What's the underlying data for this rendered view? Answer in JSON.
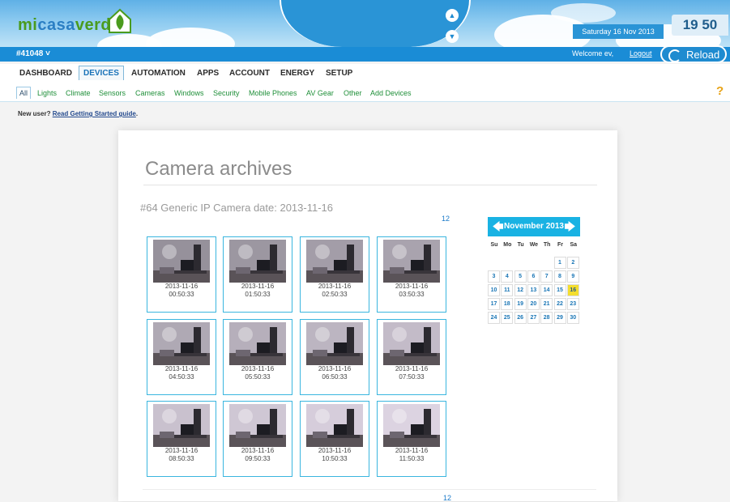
{
  "header": {
    "logo_part1": "mi",
    "logo_part2": "casa",
    "logo_part3": "verde",
    "date": "Saturday 16 Nov 2013",
    "time": "19 50",
    "device_id": "#41048",
    "welcome": "Welcome ev,",
    "logout": "Logout",
    "reload": "Reload"
  },
  "main_nav": [
    "DASHBOARD",
    "DEVICES",
    "AUTOMATION",
    "APPS",
    "ACCOUNT",
    "ENERGY",
    "SETUP"
  ],
  "main_nav_active": "DEVICES",
  "sub_nav": [
    "All",
    "Lights",
    "Climate",
    "Sensors",
    "Cameras",
    "Windows",
    "Security",
    "Mobile Phones",
    "AV Gear",
    "Other",
    "Add Devices"
  ],
  "new_user": {
    "prefix": "New user?",
    "link": "Read Getting Started guide",
    "suffix": "."
  },
  "archive": {
    "title": "Camera archives",
    "subtitle": "#64 Generic IP Camera date: 2013-11-16",
    "pages": [
      "1",
      "2"
    ],
    "thumbnails": [
      {
        "date": "2013-11-16",
        "time": "00:50:33"
      },
      {
        "date": "2013-11-16",
        "time": "01:50:33"
      },
      {
        "date": "2013-11-16",
        "time": "02:50:33"
      },
      {
        "date": "2013-11-16",
        "time": "03:50:33"
      },
      {
        "date": "2013-11-16",
        "time": "04:50:33"
      },
      {
        "date": "2013-11-16",
        "time": "05:50:33"
      },
      {
        "date": "2013-11-16",
        "time": "06:50:33"
      },
      {
        "date": "2013-11-16",
        "time": "07:50:33"
      },
      {
        "date": "2013-11-16",
        "time": "08:50:33"
      },
      {
        "date": "2013-11-16",
        "time": "09:50:33"
      },
      {
        "date": "2013-11-16",
        "time": "10:50:33"
      },
      {
        "date": "2013-11-16",
        "time": "11:50:33"
      }
    ]
  },
  "calendar": {
    "month": "November 2013",
    "days_of_week": [
      "Su",
      "Mo",
      "Tu",
      "We",
      "Th",
      "Fr",
      "Sa"
    ],
    "weeks": [
      [
        "",
        "",
        "",
        "",
        "",
        "1",
        "2"
      ],
      [
        "3",
        "4",
        "5",
        "6",
        "7",
        "8",
        "9"
      ],
      [
        "10",
        "11",
        "12",
        "13",
        "14",
        "15",
        "16"
      ],
      [
        "17",
        "18",
        "19",
        "20",
        "21",
        "22",
        "23"
      ],
      [
        "24",
        "25",
        "26",
        "27",
        "28",
        "29",
        "30"
      ]
    ],
    "selected": "16"
  },
  "colors": {
    "accent": "#1a8cd6",
    "calendar_head": "#19b2e3",
    "highlight": "#f4de2e",
    "subnav_text": "#1f8f39"
  }
}
